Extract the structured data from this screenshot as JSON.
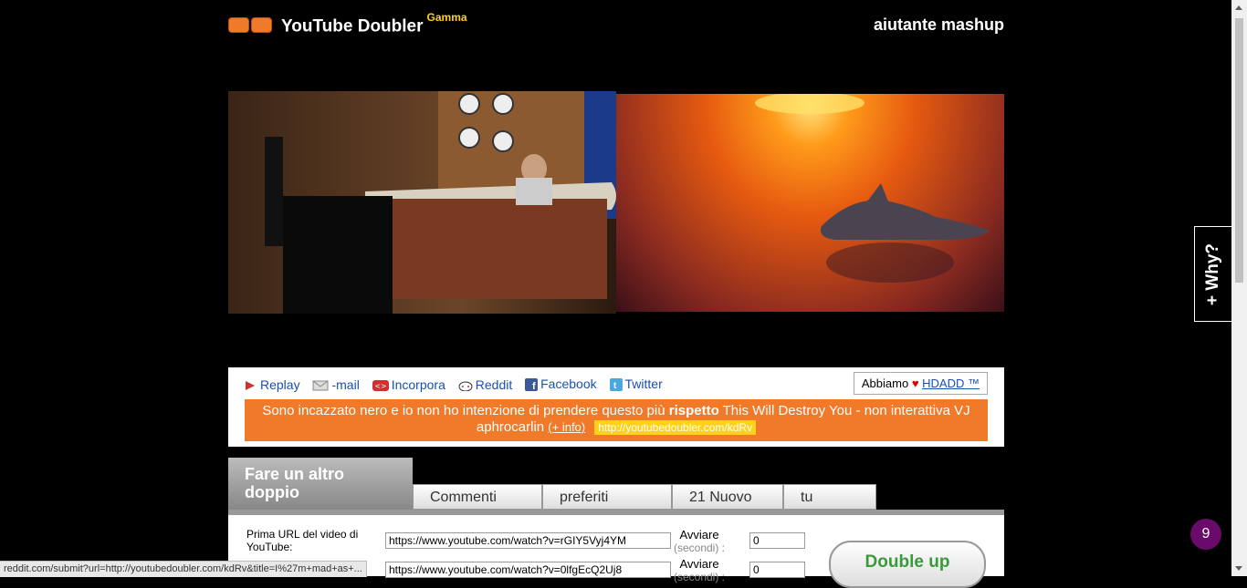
{
  "header": {
    "brand": "YouTube Doubler",
    "brand_tag": "Gamma",
    "mashup": "aiutante mashup"
  },
  "share": {
    "items": [
      {
        "label": "Replay",
        "icon": "play-icon"
      },
      {
        "label": "-mail",
        "icon": "mail-icon"
      },
      {
        "label": "Incorpora",
        "icon": "embed-icon"
      },
      {
        "label": "Reddit",
        "icon": "reddit-icon"
      },
      {
        "label": "Facebook",
        "icon": "facebook-icon"
      },
      {
        "label": "Twitter",
        "icon": "twitter-icon"
      }
    ],
    "hdadd_prefix": "Abbiamo",
    "hdadd_link": "HDADD ™"
  },
  "banner": {
    "title_part1": "Sono incazzato nero e io non ho intenzione di prendere questo più ",
    "title_bold": "rispetto",
    "title_part2": " This Will Destroy You - non interattiva VJ aphrocarlin",
    "more_info": "(+ info)",
    "url": "http://youtubedoubler.com/kdRv"
  },
  "tabs": {
    "active": "Fare un altro doppio",
    "items": [
      "Commenti",
      "preferiti",
      "21 Nuovo",
      "tu"
    ]
  },
  "form": {
    "first_label": "Prima URL del video di YouTube:",
    "first_url": "https://www.youtube.com/watch?v=rGIY5Vyj4YM",
    "second_url": "https://www.youtube.com/watch?v=0lfgEcQ2Uj8",
    "start_label": "Avviare",
    "start_unit": "(secondi) :",
    "start1": "0",
    "start2": "0",
    "double_button": "Double up"
  },
  "why": "+ Why?",
  "badge": "9",
  "status_url": "reddit.com/submit?url=http://youtubedoubler.com/kdRv&title=I%27m+mad+as+..."
}
